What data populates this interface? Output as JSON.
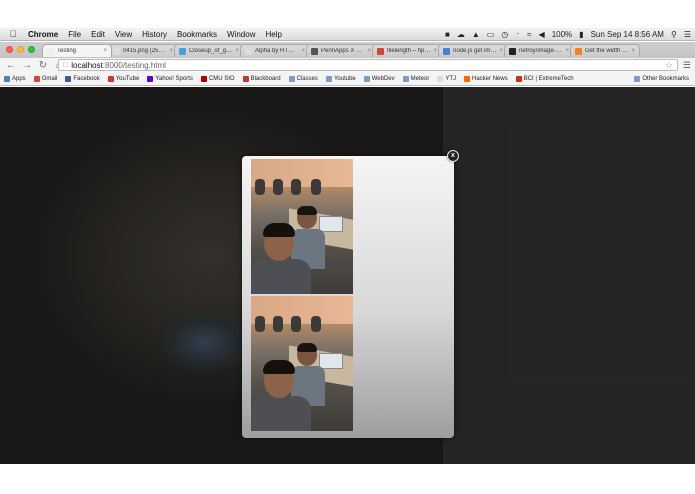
{
  "menubar": {
    "app_name": "Chrome",
    "items": [
      "File",
      "Edit",
      "View",
      "History",
      "Bookmarks",
      "Window",
      "Help"
    ],
    "battery": "100%",
    "datetime": "Sun Sep 14  8:56 AM"
  },
  "tabs": [
    {
      "label": "Testing",
      "active": true,
      "color": "#eeeeee"
    },
    {
      "label": "0415.png (256×…",
      "active": false,
      "color": "#dddddd"
    },
    {
      "label": "Closeup_of_goat…",
      "active": false,
      "color": "#4aa3d8"
    },
    {
      "label": "Alpha by HTML5…",
      "active": false,
      "color": "#dddddd"
    },
    {
      "label": "PennApps X – Fa…",
      "active": false,
      "color": "#555555"
    },
    {
      "label": "filelength – hpan…",
      "active": false,
      "color": "#d44638"
    },
    {
      "label": "node.js get imag…",
      "active": false,
      "color": "#4a7fd6"
    },
    {
      "label": "netroy/image-si…",
      "active": false,
      "color": "#222222"
    },
    {
      "label": "Get the width an…",
      "active": false,
      "color": "#f48024"
    }
  ],
  "omnibox": {
    "host": "localhost",
    "path": ":8000/testing.html"
  },
  "bookmarks": [
    {
      "label": "Apps",
      "color": "#4a7fd6"
    },
    {
      "label": "Gmail",
      "color": "#d44638"
    },
    {
      "label": "Facebook",
      "color": "#3b5998"
    },
    {
      "label": "YouTube",
      "color": "#e52d27"
    },
    {
      "label": "Yahoo! Sports",
      "color": "#5f01d1"
    },
    {
      "label": "CMU SIO",
      "color": "#b00000"
    },
    {
      "label": "Blackboard",
      "color": "#c0392b"
    },
    {
      "label": "Classes",
      "color": "#7a9cc6"
    },
    {
      "label": "Youtube",
      "color": "#7a9cc6"
    },
    {
      "label": "WebDev",
      "color": "#7a9cc6"
    },
    {
      "label": "Meteor",
      "color": "#7a9cc6"
    },
    {
      "label": "YTJ",
      "color": "#dddddd"
    },
    {
      "label": "Hacker News",
      "color": "#ff6600"
    },
    {
      "label": "BCI | ExtremeTech",
      "color": "#cc3300"
    }
  ],
  "other_bookmarks": "Other Bookmarks",
  "modal": {
    "close_label": "x"
  }
}
